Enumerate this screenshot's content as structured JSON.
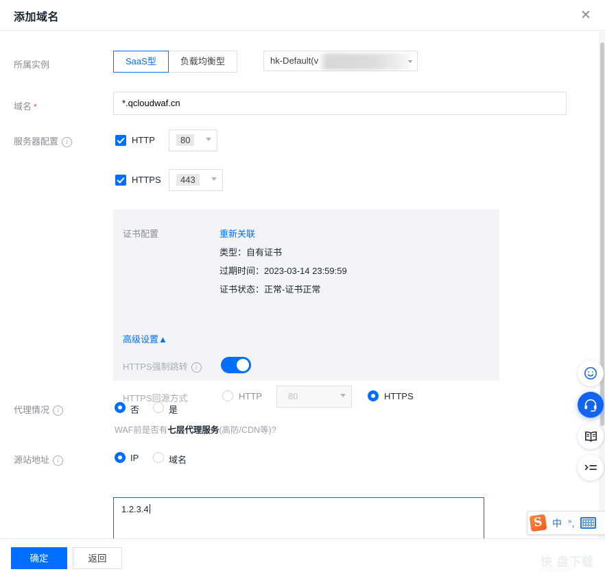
{
  "modal": {
    "title": "添加域名",
    "close_icon": "close-icon"
  },
  "fields": {
    "instance": {
      "label": "所属实例",
      "segments": [
        {
          "label": "SaaS型",
          "active": true
        },
        {
          "label": "负载均衡型",
          "active": false
        }
      ],
      "select_value": "hk-Default(v",
      "select_redacted": true
    },
    "domain": {
      "label": "域名",
      "required_mark": "*",
      "value": "*.qcloudwaf.cn"
    },
    "server_config": {
      "label": "服务器配置",
      "info_icon": "info-icon",
      "http": {
        "enabled": true,
        "protocol_label": "HTTP",
        "port": "80"
      },
      "https": {
        "enabled": true,
        "protocol_label": "HTTPS",
        "port": "443"
      }
    },
    "certificate": {
      "label": "证书配置",
      "reassociate_link": "重新关联",
      "type_line": "类型：自有证书",
      "expiry_line": "过期时间：2023-03-14 23:59:59",
      "status_line": "证书状态：正常-证书正常",
      "advanced_toggle": "高级设置",
      "advanced_toggle_caret": "▲",
      "https_force_redirect": {
        "label": "HTTPS强制跳转",
        "info_icon": "info-icon",
        "enabled": true
      },
      "https_origin_mode": {
        "label": "HTTPS回源方式",
        "options": [
          {
            "label": "HTTP",
            "selected": false
          },
          {
            "label": "HTTPS",
            "selected": true
          }
        ],
        "http_port": "80"
      }
    },
    "proxy": {
      "label": "代理情况",
      "info_icon": "info-icon",
      "options": [
        {
          "label": "否",
          "selected": true
        },
        {
          "label": "是",
          "selected": false
        }
      ],
      "hint_prefix": "WAF前是否有",
      "hint_strong": "七层代理服务",
      "hint_suffix": "(高防/CDN等)?"
    },
    "origin": {
      "label": "源站地址",
      "info_icon": "info-icon",
      "options": [
        {
          "label": "IP",
          "selected": true
        },
        {
          "label": "域名",
          "selected": false
        }
      ],
      "value": "1.2.3.4"
    }
  },
  "footer": {
    "confirm_label": "确定",
    "back_label": "返回"
  },
  "side_dock": [
    {
      "name": "feedback-smiley-icon"
    },
    {
      "name": "support-headset-icon"
    },
    {
      "name": "docs-book-icon"
    },
    {
      "name": "menu-list-icon"
    }
  ],
  "ime": {
    "logo_text": "S",
    "mode": "中",
    "punctuation": "°,",
    "keyboard_icon": "keyboard-icon"
  },
  "watermark": {
    "text": "快 盘下载",
    "sub": "KUAIPAN"
  },
  "colors": {
    "accent": "#006eff",
    "label_gray": "#888c94",
    "panel_bg": "#f3f4f7",
    "required_red": "#e54545",
    "focus_border": "#1b6a8c"
  }
}
